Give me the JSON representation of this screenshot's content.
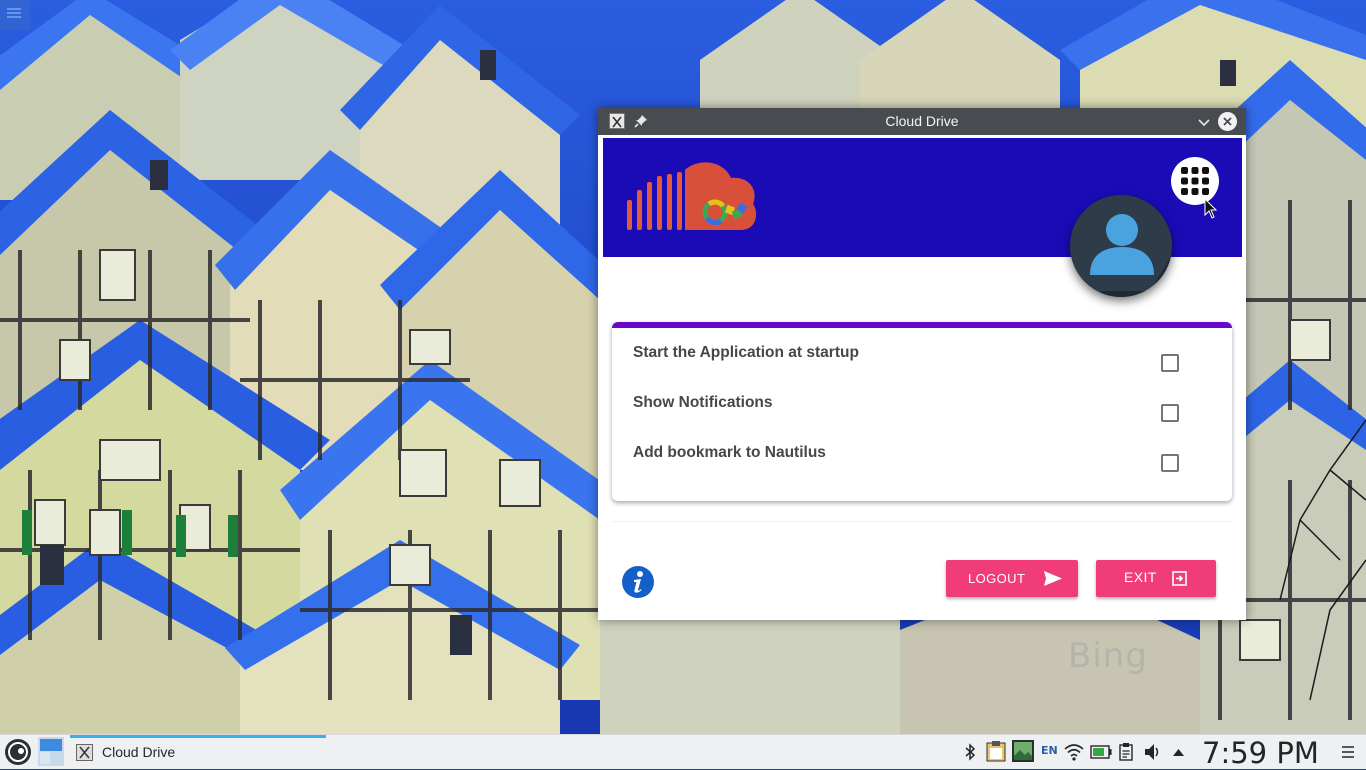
{
  "window": {
    "title": "Cloud Drive",
    "icons": [
      "app-icon",
      "pin-icon",
      "minimize-chevron-icon",
      "close-icon"
    ]
  },
  "header": {
    "logo": "cloud-drive-logo",
    "apps_icon": "apps-grid-icon",
    "avatar_icon": "user-avatar-icon"
  },
  "settings": {
    "options": [
      {
        "label": "Start the Application at startup",
        "checked": false
      },
      {
        "label": "Show Notifications",
        "checked": false
      },
      {
        "label": "Add bookmark to Nautilus",
        "checked": false
      }
    ]
  },
  "footer": {
    "info_icon": "info-icon",
    "logout_label": "LOGOUT",
    "exit_label": "EXIT"
  },
  "colors": {
    "header_bg": "#1a0bb7",
    "card_accent": "#6808c9",
    "button_bg": "#f03d7a",
    "titlebar_bg": "#484b50"
  },
  "desktop": {
    "watermark": "Bing"
  },
  "taskbar": {
    "task_label": "Cloud Drive",
    "language": "EN",
    "clock": "7:59 PM",
    "tray_icons": [
      "bluetooth-icon",
      "clipboard-icon",
      "image-viewer-icon",
      "wifi-icon",
      "battery-icon",
      "notes-icon",
      "volume-icon",
      "arrow-up-icon"
    ]
  }
}
